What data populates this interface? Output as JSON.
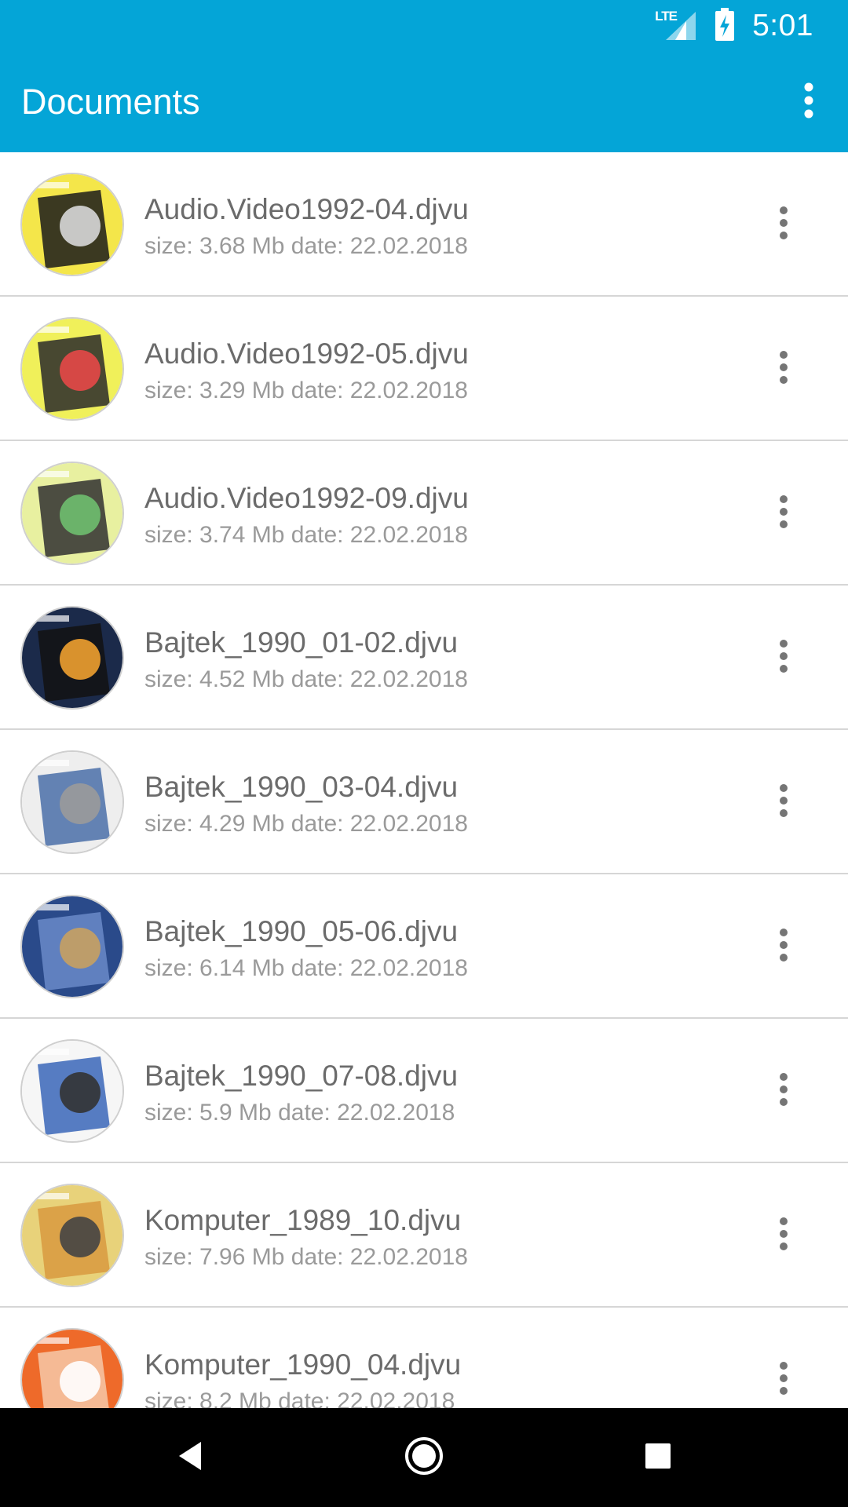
{
  "status_bar": {
    "network": "LTE",
    "time": "5:01"
  },
  "toolbar": {
    "title": "Documents",
    "overflow_icon": "more-vert-icon"
  },
  "documents": [
    {
      "name": "Audio.Video1992-04.djvu",
      "meta": "size: 3.68 Mb date: 22.02.2018",
      "thumb_colors": [
        "#f4e64a",
        "#1a1a1a",
        "#d8d8d8"
      ]
    },
    {
      "name": "Audio.Video1992-05.djvu",
      "meta": "size: 3.29 Mb date: 22.02.2018",
      "thumb_colors": [
        "#f0f05a",
        "#2a2a2a",
        "#e54848"
      ]
    },
    {
      "name": "Audio.Video1992-09.djvu",
      "meta": "size: 3.74 Mb date: 22.02.2018",
      "thumb_colors": [
        "#e8f0a0",
        "#303030",
        "#6fbf6f"
      ]
    },
    {
      "name": "Bajtek_1990_01-02.djvu",
      "meta": "size: 4.52 Mb date: 22.02.2018",
      "thumb_colors": [
        "#1b2a4a",
        "#121212",
        "#f0a030"
      ]
    },
    {
      "name": "Bajtek_1990_03-04.djvu",
      "meta": "size: 4.29 Mb date: 22.02.2018",
      "thumb_colors": [
        "#eeeeee",
        "#4a6ea8",
        "#9a9a9a"
      ]
    },
    {
      "name": "Bajtek_1990_05-06.djvu",
      "meta": "size: 6.14 Mb date: 22.02.2018",
      "thumb_colors": [
        "#2a4a8a",
        "#6a8ac8",
        "#c8a060"
      ]
    },
    {
      "name": "Bajtek_1990_07-08.djvu",
      "meta": "size: 5.9 Mb date: 22.02.2018",
      "thumb_colors": [
        "#f6f6f6",
        "#3a66b8",
        "#333333"
      ]
    },
    {
      "name": "Komputer_1989_10.djvu",
      "meta": "size: 7.96 Mb date: 22.02.2018",
      "thumb_colors": [
        "#e8d27a",
        "#d89a40",
        "#444444"
      ]
    },
    {
      "name": "Komputer_1990_04.djvu",
      "meta": "size: 8.2 Mb date: 22.02.2018",
      "thumb_colors": [
        "#ee6a2a",
        "#f6c8a8",
        "#ffffff"
      ]
    }
  ],
  "nav_bar": {
    "back_icon": "back-triangle-icon",
    "home_icon": "home-circle-icon",
    "recents_icon": "recents-square-icon"
  },
  "colors": {
    "app_bar": "#04a5d7",
    "nav_bar": "#000000",
    "title_text": "#6b6b6b",
    "meta_text": "#9a9a9a",
    "divider": "#d6d6d6"
  }
}
